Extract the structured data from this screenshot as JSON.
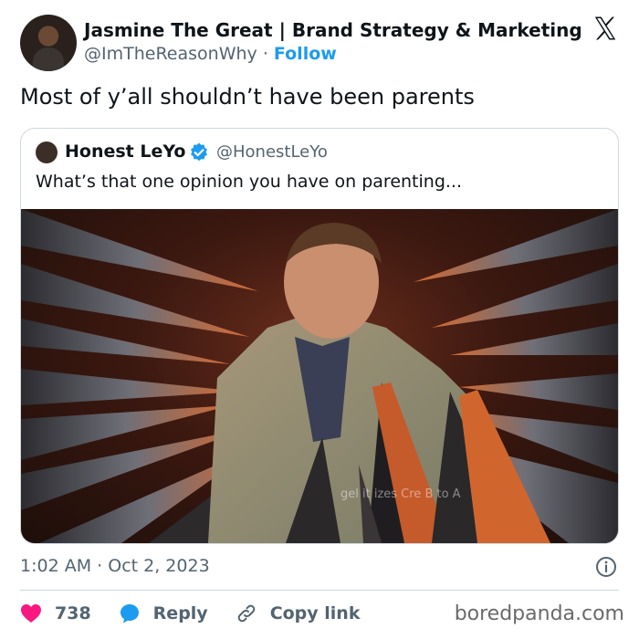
{
  "author": {
    "name": "Jasmine The Great | Brand Strategy & Marketing",
    "handle": "@ImTheReasonWhy",
    "separator": "·",
    "follow_label": "Follow"
  },
  "tweet": {
    "text": "Most of y’all shouldn’t have been parents",
    "time": "1:02 AM",
    "separator": "·",
    "date": "Oct 2, 2023"
  },
  "quoted": {
    "name": "Honest LeYo",
    "handle": "@HonestLeYo",
    "text": "What’s that one opinion you have on parenting...",
    "media_watermark": "gel it izes Cre B to A"
  },
  "actions": {
    "likes_count": "738",
    "reply_label": "Reply",
    "copy_link_label": "Copy link"
  },
  "watermark": "boredpanda.com",
  "icons": {
    "platform": "x-logo-icon",
    "verified": "verified-badge-icon",
    "info": "info-icon",
    "like": "heart-icon",
    "reply": "reply-bubble-icon",
    "link": "link-icon"
  },
  "colors": {
    "accent": "#1d9bf0",
    "like": "#f91880",
    "text": "#0f1419",
    "muted": "#536471",
    "border": "#cfd9de"
  }
}
